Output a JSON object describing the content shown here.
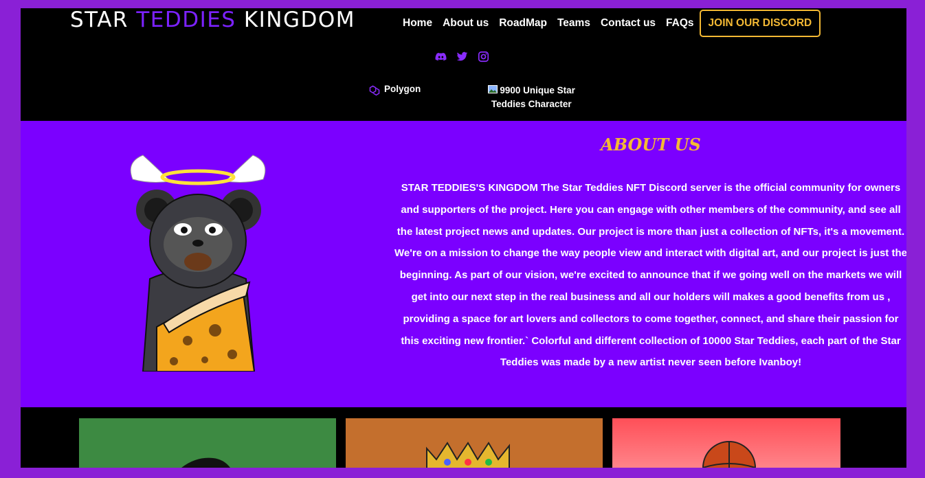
{
  "header": {
    "logo_part1": "STAR ",
    "logo_part2": "TEDDIES",
    "logo_part3": " KINGDOM",
    "nav": [
      "Home",
      "About us",
      "RoadMap",
      "Teams",
      "Contact us",
      "FAQs"
    ],
    "discord_button": "JOIN OUR DISCORD",
    "socials": [
      "discord-icon",
      "twitter-icon",
      "instagram-icon"
    ],
    "meta": {
      "chain": "Polygon",
      "supply": "9900 Unique Star Teddies Character"
    }
  },
  "about": {
    "title": "ABOUT US",
    "body": "STAR TEDDIES'S KINGDOM The Star Teddies NFT Discord server is the official community for owners and supporters of the project. Here you can engage with other members of the community, and see all the latest project news and updates. Our project is more than just a collection of NFTs, it's a movement. We're on a mission to change the way people view and interact with digital art, and our project is just the beginning. As part of our vision, we're excited to announce that if we going well on the markets we will get into our next step in the real business and all our holders will makes a good benefits from us , providing a space for art lovers and collectors to come together, connect, and share their passion for this exciting new frontier.` Colorful and different collection of 10000 Star Teddies, each part of the Star Teddies was made by a new artist never seen before Ivanboy!"
  },
  "colors": {
    "page_bg": "#8a20d6",
    "header_bg": "#000000",
    "about_bg": "#7b00ff",
    "accent_purple": "#7c22ff",
    "accent_gold": "#f4b934"
  }
}
